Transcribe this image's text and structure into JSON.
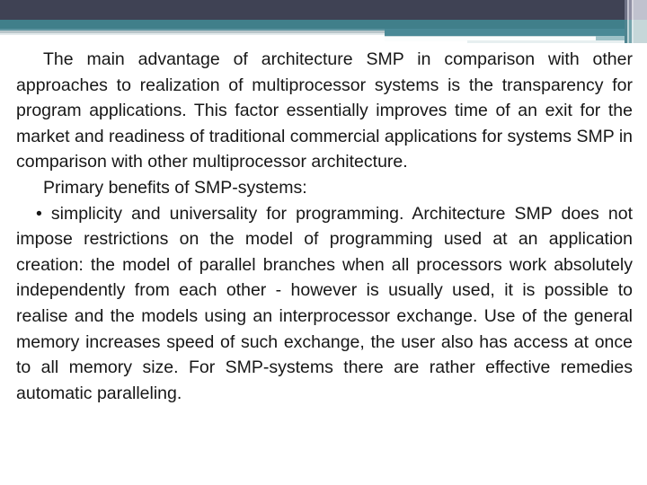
{
  "slide": {
    "decor": {
      "navy": "#3f4254",
      "teal": "#407f8a",
      "teal_light": "#5e95a0",
      "gray": "#b9c6ca",
      "pale": "#e3eaec",
      "stripe_gray": "#c0c2ce",
      "stripe_purple": "#8e8fa3"
    },
    "body": {
      "paragraph_1": "The main advantage of architecture SMP in comparison with other approaches to realization of multiprocessor systems is the transparency for program applications. This factor essentially improves time of an exit for the market and readiness of traditional commercial applications for systems SMP in comparison with other multiprocessor architecture.",
      "paragraph_2": "Primary benefits of SMP-systems:",
      "paragraph_3": "• simplicity and universality for programming. Architecture SMP does not impose restrictions on the model of programming used at an application creation: the model of parallel branches when all processors work absolutely independently from each other - however is usually used, it is possible to realise and the models using an interprocessor exchange. Use of the general memory increases speed of such exchange, the user also has access at once to all memory size. For SMP-systems there are rather effective remedies automatic paralleling."
    }
  }
}
